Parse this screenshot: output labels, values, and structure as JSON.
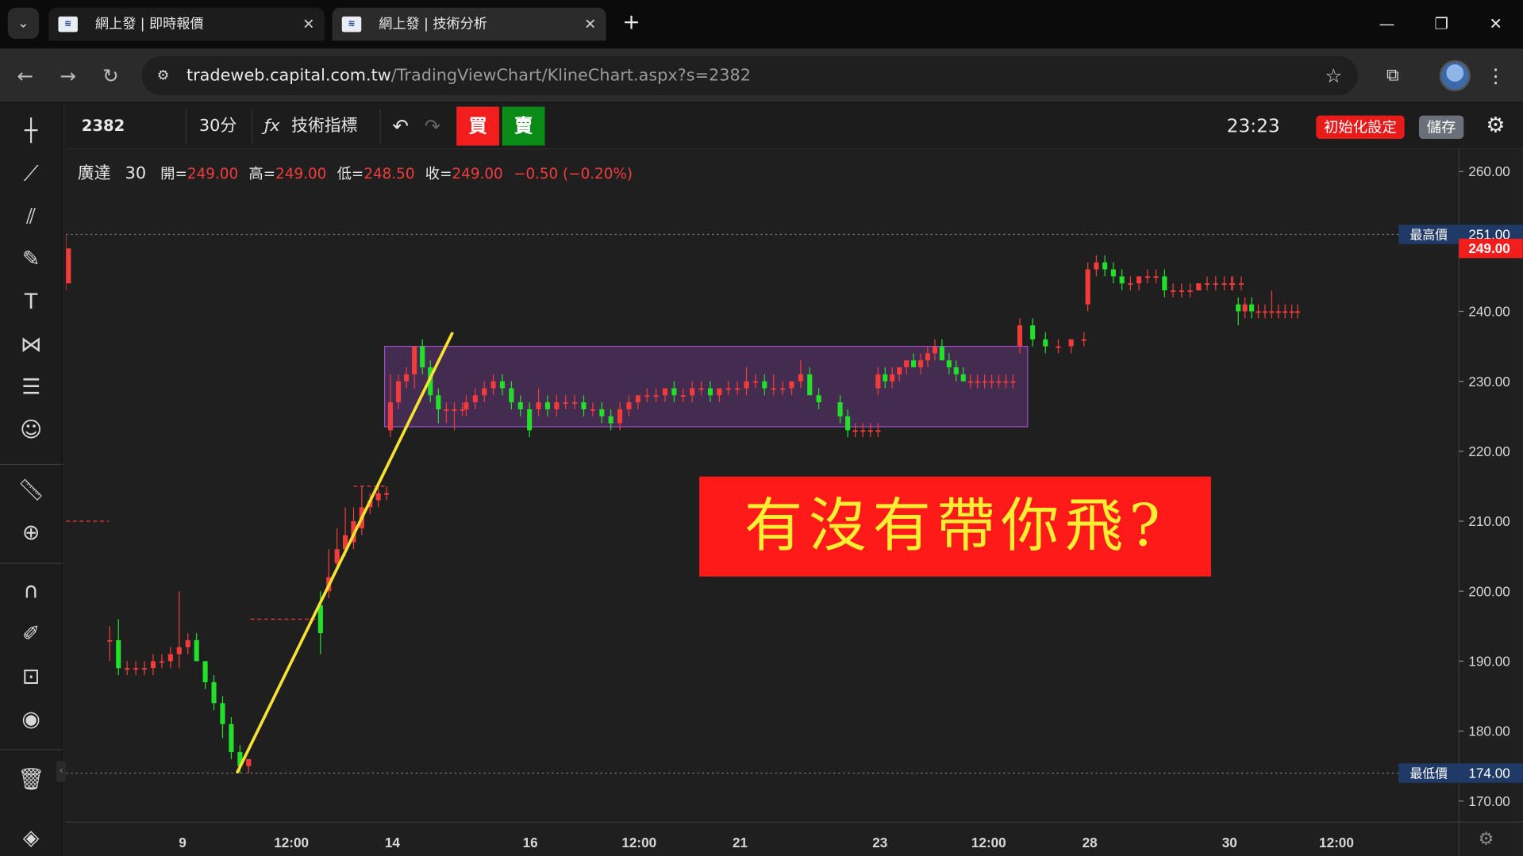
{
  "browser": {
    "tabs": [
      {
        "label": "網上發 | 即時報價",
        "favicon": "capital-logo"
      },
      {
        "label": "網上發 | 技術分析",
        "favicon": "capital-logo"
      }
    ],
    "url_host": "tradeweb.capital.com.tw",
    "url_path": "/TradingViewChart/KlineChart.aspx?s=2382"
  },
  "topbar": {
    "symbol": "2382",
    "interval": "30分",
    "indicators_label": "技術指標",
    "buy_label": "買",
    "sell_label": "賣",
    "clock": "23:23",
    "reset_label": "初始化設定",
    "save_label": "儲存"
  },
  "legend": {
    "name": "廣達",
    "interval": "30",
    "open_label": "開=",
    "open": "249.00",
    "high_label": "高=",
    "high": "249.00",
    "low_label": "低=",
    "low": "248.50",
    "close_label": "收=",
    "close": "249.00",
    "change": "−0.50 (−0.20%)"
  },
  "banner_text": "有沒有帶你飛?",
  "colors": {
    "up": "#f23c3c",
    "down": "#22e02a",
    "trendline": "#f8e231",
    "box_fill": "rgba(128,64,160,0.38)",
    "box_stroke": "#9b4fc9"
  },
  "chart_data": {
    "type": "candlestick",
    "symbol": "2382",
    "name": "廣達",
    "interval": "30",
    "ylim": [
      167,
      263
    ],
    "y_ticks": [
      "260.00",
      "250.00",
      "240.00",
      "230.00",
      "220.00",
      "210.00",
      "200.00",
      "190.00",
      "180.00",
      "170.00"
    ],
    "x_ticks": [
      "9",
      "12:00",
      "14",
      "16",
      "12:00",
      "21",
      "23",
      "12:00",
      "28",
      "30",
      "12:00"
    ],
    "highest": {
      "label": "最高價",
      "value": "251.00"
    },
    "last": {
      "value": "249.00"
    },
    "lowest": {
      "label": "最低價",
      "value": "174.00"
    },
    "candles": [
      [
        193,
        195,
        190,
        193
      ],
      [
        193,
        196,
        188,
        189
      ],
      [
        189,
        190,
        188,
        189
      ],
      [
        189,
        190,
        188,
        189
      ],
      [
        189,
        190,
        188,
        189
      ],
      [
        189,
        191,
        188,
        190
      ],
      [
        190,
        191,
        189,
        190
      ],
      [
        190,
        192,
        189,
        191
      ],
      [
        191,
        200,
        189,
        192
      ],
      [
        192,
        194,
        191,
        193
      ],
      [
        193,
        194,
        190,
        190
      ],
      [
        190,
        190,
        186,
        187
      ],
      [
        187,
        188,
        183,
        184
      ],
      [
        184,
        185,
        179,
        181
      ],
      [
        181,
        182,
        176,
        177
      ],
      [
        177,
        178,
        174,
        175
      ],
      [
        175,
        176,
        174,
        176
      ],
      [
        198,
        200,
        191,
        194
      ],
      [
        200,
        206,
        199,
        202
      ],
      [
        204,
        209,
        203,
        206
      ],
      [
        206,
        212,
        205,
        208
      ],
      [
        207,
        212,
        206,
        210
      ],
      [
        209,
        215,
        208,
        212
      ],
      [
        212,
        214,
        211,
        213
      ],
      [
        213,
        215,
        212,
        214
      ],
      [
        214,
        215,
        213,
        214
      ],
      [
        223,
        231,
        222,
        227
      ],
      [
        227,
        231,
        226,
        230
      ],
      [
        230,
        232,
        229,
        231
      ],
      [
        231,
        235,
        229,
        235
      ],
      [
        235,
        236,
        231,
        232
      ],
      [
        232,
        233,
        227,
        228
      ],
      [
        228,
        229,
        224,
        226
      ],
      [
        226,
        227,
        224,
        226
      ],
      [
        226,
        227,
        223,
        226
      ],
      [
        226,
        227,
        225,
        226
      ],
      [
        226,
        228,
        225,
        227
      ],
      [
        227,
        229,
        226,
        228
      ],
      [
        228,
        230,
        227,
        229
      ],
      [
        229,
        231,
        228,
        230
      ],
      [
        230,
        231,
        228,
        229
      ],
      [
        229,
        230,
        226,
        227
      ],
      [
        227,
        228,
        225,
        226
      ],
      [
        226,
        227,
        222,
        223
      ],
      [
        226,
        229,
        225,
        227
      ],
      [
        227,
        228,
        225,
        226
      ],
      [
        226,
        228,
        225,
        227
      ],
      [
        227,
        228,
        226,
        227
      ],
      [
        227,
        228,
        226,
        227
      ],
      [
        227,
        228,
        225,
        226
      ],
      [
        226,
        227,
        225,
        226
      ],
      [
        226,
        227,
        224,
        225
      ],
      [
        225,
        226,
        223,
        224
      ],
      [
        224,
        227,
        223,
        226
      ],
      [
        226,
        228,
        225,
        227
      ],
      [
        227,
        228,
        226,
        228
      ],
      [
        228,
        229,
        227,
        228
      ],
      [
        228,
        229,
        227,
        228
      ],
      [
        228,
        229,
        227,
        229
      ],
      [
        229,
        230,
        227,
        228
      ],
      [
        228,
        229,
        227,
        228
      ],
      [
        228,
        230,
        227,
        229
      ],
      [
        229,
        230,
        228,
        229
      ],
      [
        229,
        230,
        227,
        228
      ],
      [
        228,
        229,
        227,
        229
      ],
      [
        229,
        230,
        228,
        229
      ],
      [
        229,
        230,
        228,
        229
      ],
      [
        229,
        232,
        228,
        230
      ],
      [
        230,
        231,
        229,
        230
      ],
      [
        230,
        231,
        228,
        229
      ],
      [
        229,
        231,
        228,
        229
      ],
      [
        229,
        230,
        228,
        229
      ],
      [
        229,
        230,
        228,
        230
      ],
      [
        230,
        233,
        229,
        231
      ],
      [
        231,
        232,
        228,
        228
      ],
      [
        228,
        229,
        226,
        227
      ],
      [
        227,
        228,
        224,
        225
      ],
      [
        225,
        226,
        222,
        223
      ],
      [
        223,
        224,
        222,
        223
      ],
      [
        223,
        224,
        222,
        223
      ],
      [
        223,
        224,
        222,
        223
      ],
      [
        223,
        224,
        222,
        223
      ],
      [
        229,
        232,
        228,
        231
      ],
      [
        231,
        232,
        229,
        230
      ],
      [
        230,
        232,
        229,
        231
      ],
      [
        231,
        232,
        230,
        232
      ],
      [
        232,
        233,
        231,
        233
      ],
      [
        233,
        234,
        232,
        232
      ],
      [
        232,
        234,
        231,
        233
      ],
      [
        233,
        235,
        232,
        234
      ],
      [
        234,
        236,
        233,
        235
      ],
      [
        235,
        236,
        233,
        233
      ],
      [
        233,
        234,
        231,
        232
      ],
      [
        232,
        233,
        230,
        231
      ],
      [
        231,
        232,
        230,
        230
      ],
      [
        230,
        231,
        229,
        230
      ],
      [
        230,
        231,
        229,
        230
      ],
      [
        230,
        231,
        229,
        230
      ],
      [
        230,
        231,
        229,
        230
      ],
      [
        230,
        231,
        229,
        230
      ],
      [
        230,
        231,
        229,
        230
      ],
      [
        230,
        231,
        229,
        230
      ],
      [
        235,
        239,
        234,
        238
      ],
      [
        238,
        239,
        235,
        236
      ],
      [
        236,
        237,
        234,
        235
      ],
      [
        235,
        236,
        234,
        235
      ],
      [
        235,
        236,
        234,
        236
      ],
      [
        236,
        237,
        235,
        236
      ],
      [
        241,
        247,
        240,
        246
      ],
      [
        246,
        248,
        245,
        247
      ],
      [
        247,
        248,
        245,
        246
      ],
      [
        246,
        247,
        244,
        245
      ],
      [
        245,
        246,
        243,
        244
      ],
      [
        244,
        245,
        243,
        244
      ],
      [
        244,
        245,
        243,
        245
      ],
      [
        245,
        246,
        244,
        245
      ],
      [
        245,
        246,
        244,
        245
      ],
      [
        245,
        246,
        242,
        243
      ],
      [
        243,
        244,
        242,
        243
      ],
      [
        243,
        244,
        242,
        243
      ],
      [
        243,
        244,
        242,
        243
      ],
      [
        243,
        244,
        243,
        244
      ],
      [
        244,
        245,
        243,
        244
      ],
      [
        244,
        245,
        243,
        244
      ],
      [
        244,
        245,
        243,
        244
      ],
      [
        244,
        245,
        243,
        244
      ],
      [
        244,
        245,
        243,
        244
      ],
      [
        244,
        245,
        243,
        244
      ],
      [
        241,
        242,
        238,
        240
      ],
      [
        240,
        242,
        239,
        241
      ],
      [
        241,
        242,
        239,
        240
      ],
      [
        240,
        241,
        239,
        240
      ],
      [
        240,
        241,
        239,
        240
      ],
      [
        240,
        243,
        239,
        240
      ],
      [
        240,
        241,
        239,
        240
      ],
      [
        240,
        241,
        239,
        240
      ],
      [
        240,
        241,
        239,
        240
      ],
      [
        240,
        241,
        239,
        240
      ],
      [
        244,
        251,
        243,
        249
      ]
    ],
    "candle_order": "open, high, low, close",
    "annotations": [
      {
        "type": "trendline",
        "from": [
          174,
          "9 afternoon"
        ],
        "to": [
          237,
          "14"
        ]
      },
      {
        "type": "rectangle",
        "y_range": [
          223.5,
          235
        ],
        "x_range": [
          "14",
          "23 after 12:00"
        ]
      },
      {
        "type": "dashed-level",
        "value": 210
      },
      {
        "type": "dashed-level",
        "value": 196
      },
      {
        "type": "dashed-level",
        "value": 215
      }
    ]
  }
}
